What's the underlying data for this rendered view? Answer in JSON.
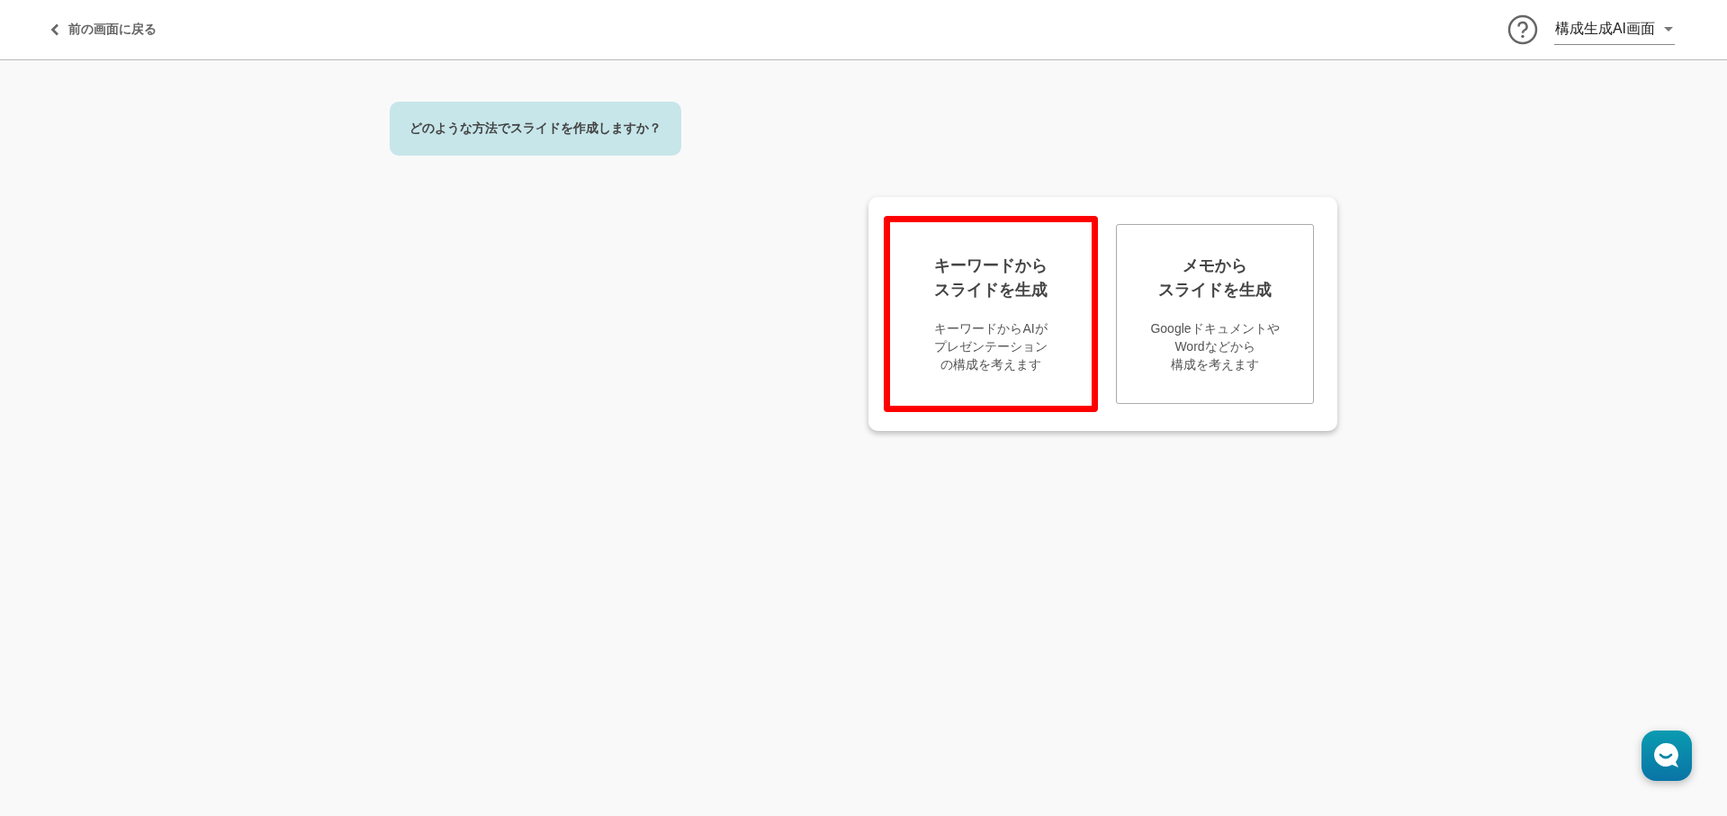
{
  "header": {
    "back_link": "前の画面に戻る",
    "mode_select": {
      "value": "構成生成AI画面"
    }
  },
  "prompt": "どのような方法でスライドを作成しますか？",
  "options": [
    {
      "title_lines": [
        "キーワードから",
        "スライドを生成"
      ],
      "description_lines": [
        "キーワードからAIが",
        "プレゼンテーション",
        "の構成を考えます"
      ],
      "highlighted": true
    },
    {
      "title_lines": [
        "メモから",
        "スライドを生成"
      ],
      "description_lines": [
        "Googleドキュメントや",
        "Wordなどから",
        "構成を考えます"
      ],
      "highlighted": false
    }
  ]
}
